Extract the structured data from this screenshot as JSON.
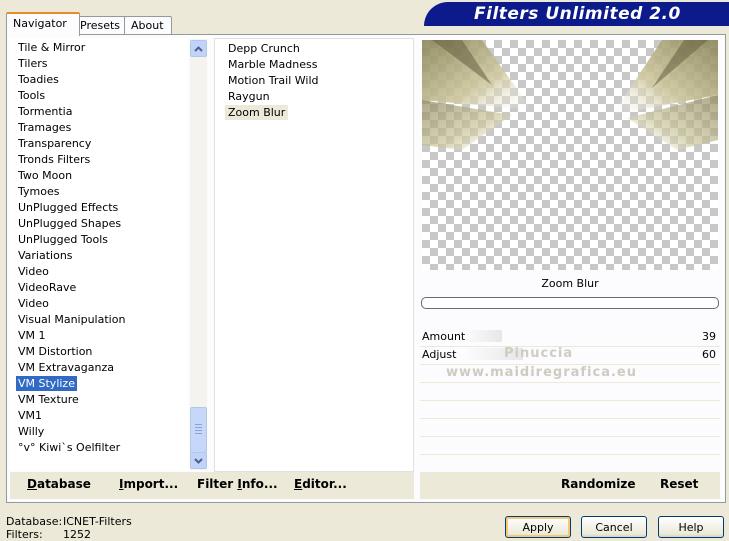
{
  "tabs": [
    {
      "label": "Navigator",
      "active": true
    },
    {
      "label": "Presets",
      "active": false
    },
    {
      "label": "About",
      "active": false
    }
  ],
  "banner": {
    "title": "Filters Unlimited 2.0"
  },
  "categories": [
    "Tile & Mirror",
    "Tilers",
    "Toadies",
    "Tools",
    "Tormentia",
    "Tramages",
    "Transparency",
    "Tronds Filters",
    "Two Moon",
    "Tymoes",
    "UnPlugged Effects",
    "UnPlugged Shapes",
    "UnPlugged Tools",
    "Variations",
    "Video",
    "VideoRave",
    "Video",
    "Visual Manipulation",
    "VM 1",
    "VM Distortion",
    "VM Extravaganza",
    "VM Stylize",
    "VM Texture",
    "VM1",
    "Willy",
    "°v° Kiwi`s Oelfilter"
  ],
  "selected_category": "VM Stylize",
  "filters": [
    "Depp Crunch",
    "Marble Madness",
    "Motion Trail Wild",
    "Raygun",
    "Zoom Blur"
  ],
  "selected_filter": "Zoom Blur",
  "preview": {
    "label": "Zoom Blur"
  },
  "sliders": [
    {
      "name": "Amount",
      "value": "39",
      "level": 39
    },
    {
      "name": "Adjust",
      "value": "60",
      "level": 60
    }
  ],
  "watermarks": [
    "Pinuccia",
    "www.maidiregrafica.eu"
  ],
  "toolbar": {
    "database": {
      "u": "D",
      "rest": "atabase"
    },
    "import": {
      "u": "I",
      "pre": "",
      "rest": "mport..."
    },
    "filter_info": {
      "pre": "Filter ",
      "u": "I",
      "rest": "nfo..."
    },
    "editor": {
      "u": "E",
      "rest": "ditor..."
    },
    "randomize": "Randomize",
    "reset": "Reset"
  },
  "footer": {
    "database_label": "Database:",
    "database_value": "ICNET-Filters",
    "filters_label": "Filters:",
    "filters_value": "1252"
  },
  "buttons": {
    "apply": "Apply",
    "cancel": "Cancel",
    "help": "Help"
  }
}
